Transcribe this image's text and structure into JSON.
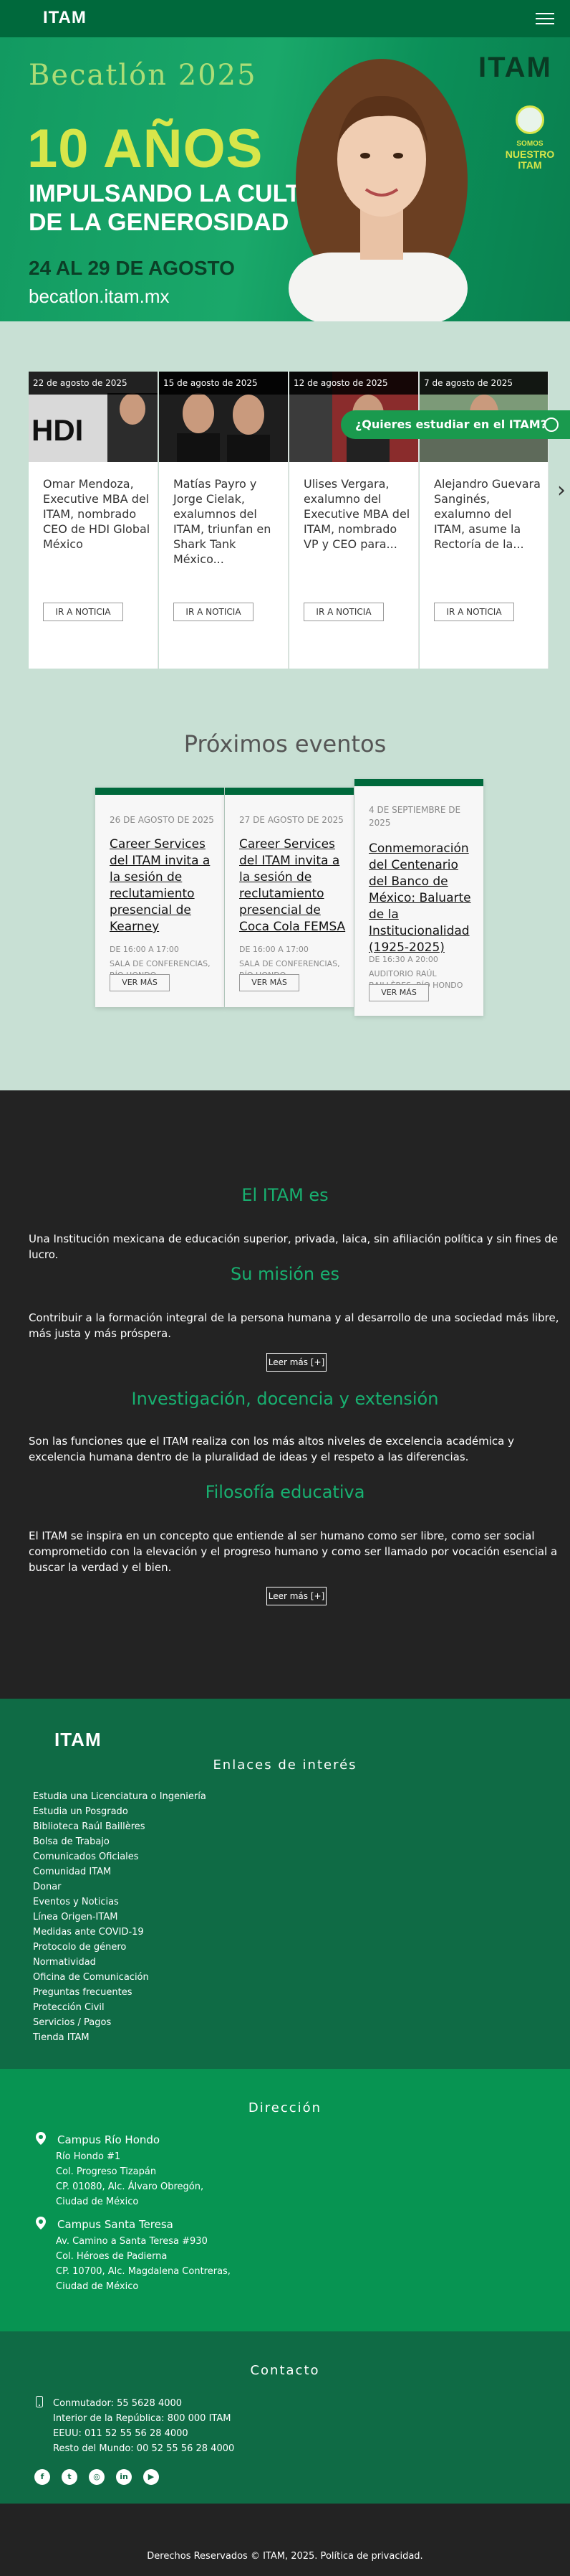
{
  "header": {
    "logo": "ITAM",
    "menu_icon": "hamburger-menu-icon"
  },
  "hero": {
    "becatlon": "Becatlón 2025",
    "headline": "10 AÑOS",
    "subline1": "IMPULSANDO LA CULTURA",
    "subline2": "DE LA GENEROSIDAD",
    "dates": "24 AL 29 DE AGOSTO",
    "url": "becatlon.itam.mx",
    "logo": "ITAM",
    "badge_line1": "SOMOS",
    "badge_line2": "NUESTRO",
    "badge_line3": "ITAM"
  },
  "news": [
    {
      "date": "22 de agosto de 2025",
      "title": "Omar Mendoza, Executive MBA del ITAM, nombrado CEO de HDI Global México",
      "button": "IR A NOTICIA",
      "image_label": "HDI"
    },
    {
      "date": "15 de agosto de 2025",
      "title": "Matías Payro y Jorge Cielak, exalumnos del ITAM, triunfan en Shark Tank México...",
      "button": "IR A NOTICIA"
    },
    {
      "date": "12 de agosto de 2025",
      "title": "Ulises Vergara, exalumno del Executive MBA del ITAM, nombrado VP y CEO para...",
      "button": "IR A NOTICIA"
    },
    {
      "date": "7 de agosto de 2025",
      "title": "Alejandro Guevara Sanginés, exalumno del ITAM, asume la Rectoría de la...",
      "button": "IR A NOTICIA"
    }
  ],
  "whatsapp": {
    "label": "¿Quieres estudiar en el ITAM?"
  },
  "events": {
    "title": "Próximos eventos",
    "items": [
      {
        "date": "26 DE AGOSTO DE 2025",
        "title": "Career Services del ITAM invita a la sesión de reclutamiento presencial de Kearney",
        "time": "DE 16:00 A 17:00",
        "place": "SALA DE CONFERENCIAS, RÍO HONDO",
        "button": "VER MÁS"
      },
      {
        "date": "27 DE AGOSTO DE 2025",
        "title": "Career Services del ITAM invita a la sesión de reclutamiento presencial de Coca Cola FEMSA",
        "time": "DE 16:00 A 17:00",
        "place": "SALA DE CONFERENCIAS, RÍO HONDO",
        "button": "VER MÁS"
      },
      {
        "date": "4 DE SEPTIEMBRE DE 2025",
        "title": "Conmemoración del Centenario del Banco de México: Baluarte de la Institucionalidad (1925-2025)",
        "time": "DE 16:30 A 20:00",
        "place": "AUDITORIO RAÚL BAILLÈRES, RÍO HONDO",
        "button": "VER MÁS"
      }
    ]
  },
  "about": {
    "h1": "El ITAM es",
    "p1": "Una Institución mexicana de educación superior, privada, laica, sin afiliación política y sin fines de lucro.",
    "h2": "Su misión es",
    "p2": "Contribuir a la formación integral de la persona humana y al desarrollo de una sociedad más libre, más justa y más próspera.",
    "btn1": "Leer más [+]",
    "h3": "Investigación, docencia y extensión",
    "p3": "Son las funciones que el ITAM realiza con los más altos niveles de excelencia académica y excelencia humana dentro de la pluralidad de ideas y el respeto a las diferencias.",
    "h4": "Filosofía educativa",
    "p4": "El ITAM se inspira en un concepto que entiende al ser humano como ser libre, como ser social comprometido con la elevación y el progreso humano y como ser llamado por vocación esencial a buscar la verdad y el bien.",
    "btn2": "Leer más [+]"
  },
  "footer": {
    "logo": "ITAM",
    "links_title": "Enlaces de interés",
    "links": [
      "Estudia una Licenciatura o Ingeniería",
      "Estudia un Posgrado",
      "Biblioteca Raúl Baillères",
      "Bolsa de Trabajo",
      "Comunicados Oficiales",
      "Comunidad ITAM",
      "Donar",
      "Eventos y Noticias",
      "Línea Origen-ITAM",
      "Medidas ante COVID-19",
      "Protocolo de género",
      "Normatividad",
      "Oficina de Comunicación",
      "Preguntas frecuentes",
      "Protección Civil",
      "Servicios / Pagos",
      "Tienda ITAM"
    ],
    "address_title": "Dirección",
    "campus1": {
      "name": "Campus Río Hondo",
      "lines": [
        "Río Hondo #1",
        "Col. Progreso Tizapán",
        "CP. 01080, Alc. Álvaro Obregón,",
        "Ciudad de México"
      ]
    },
    "campus2": {
      "name": "Campus Santa Teresa",
      "lines": [
        "Av. Camino a Santa Teresa #930",
        "Col. Héroes de Padierna",
        "CP. 10700, Alc. Magdalena Contreras,",
        "Ciudad de México"
      ]
    },
    "contact_title": "Contacto",
    "contact_lines": [
      "Conmutador: 55 5628 4000",
      "Interior de la República: 800 000 ITAM",
      "EEUU: 011 52 55 56 28 4000",
      "Resto del Mundo: 00 52 55 56 28 4000"
    ],
    "social": [
      "facebook-icon",
      "twitter-icon",
      "instagram-icon",
      "linkedin-icon",
      "youtube-icon"
    ],
    "social_glyphs": [
      "f",
      "t",
      "◎",
      "in",
      "▶"
    ],
    "copyright": "Derechos Reservados © ITAM, 2025. Política de privacidad."
  }
}
